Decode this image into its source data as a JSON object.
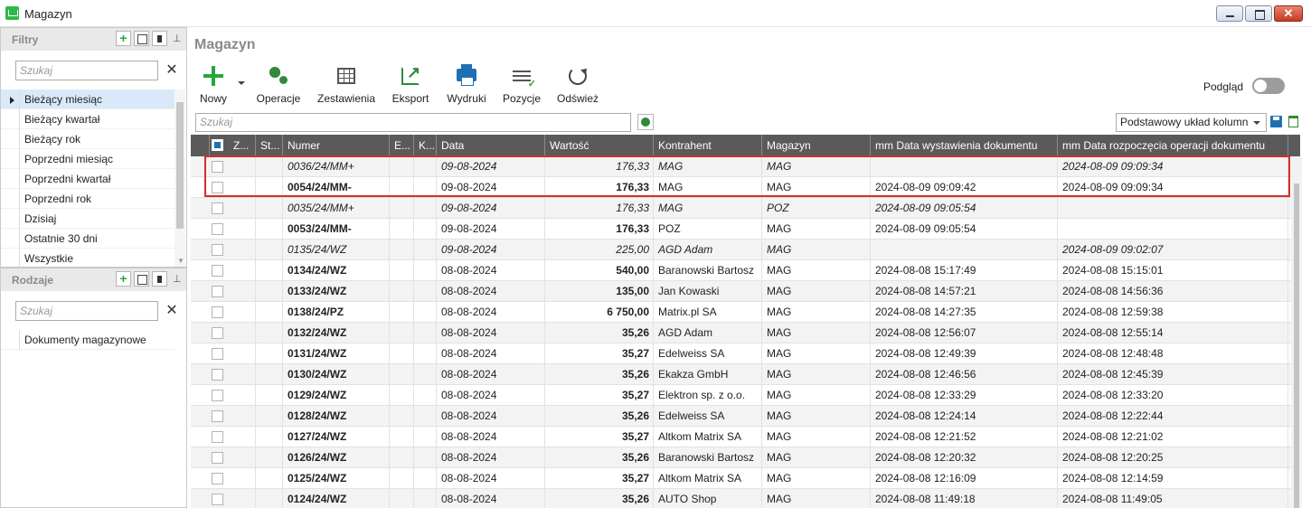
{
  "window": {
    "title": "Magazyn",
    "close_glyph": "✕"
  },
  "filters": {
    "title": "Filtry",
    "search_placeholder": "Szukaj",
    "items": [
      {
        "label": "Bieżący miesiąc",
        "active": true
      },
      {
        "label": "Bieżący kwartał"
      },
      {
        "label": "Bieżący rok"
      },
      {
        "label": "Poprzedni miesiąc"
      },
      {
        "label": "Poprzedni kwartał"
      },
      {
        "label": "Poprzedni rok"
      },
      {
        "label": "Dzisiaj"
      },
      {
        "label": "Ostatnie 30 dni"
      },
      {
        "label": "Wszystkie"
      }
    ]
  },
  "types": {
    "title": "Rodzaje",
    "search_placeholder": "Szukaj",
    "items": [
      {
        "label": "Dokumenty magazynowe"
      }
    ]
  },
  "main": {
    "title": "Magazyn",
    "toolbar": {
      "new": "Nowy",
      "operations": "Operacje",
      "reports": "Zestawienia",
      "export": "Eksport",
      "prints": "Wydruki",
      "items": "Pozycje",
      "refresh": "Odśwież"
    },
    "preview_label": "Podgląd",
    "preview_on": false,
    "grid_search_placeholder": "Szukaj",
    "layout_select": "Podstawowy układ kolumn"
  },
  "grid": {
    "columns": [
      "Z...",
      "St...",
      "Numer",
      "E...",
      "K...",
      "Data",
      "Wartość",
      "Kontrahent",
      "Magazyn",
      "mm Data wystawienia dokumentu",
      "mm Data rozpoczęcia operacji dokumentu"
    ],
    "rows": [
      {
        "draft": true,
        "numer": "0036/24/MM+",
        "data": "09-08-2024",
        "wartosc": "176,33",
        "kontrahent": "MAG",
        "magazyn": "MAG",
        "wystawienia": "",
        "rozpoczecia": "2024-08-09 09:09:34"
      },
      {
        "draft": false,
        "numer": "0054/24/MM-",
        "data": "09-08-2024",
        "wartosc": "176,33",
        "kontrahent": "MAG",
        "magazyn": "MAG",
        "wystawienia": "2024-08-09 09:09:42",
        "rozpoczecia": "2024-08-09 09:09:34"
      },
      {
        "draft": true,
        "numer": "0035/24/MM+",
        "data": "09-08-2024",
        "wartosc": "176,33",
        "kontrahent": "MAG",
        "magazyn": "POZ",
        "wystawienia": "2024-08-09 09:05:54",
        "rozpoczecia": ""
      },
      {
        "draft": false,
        "numer": "0053/24/MM-",
        "data": "09-08-2024",
        "wartosc": "176,33",
        "kontrahent": "POZ",
        "magazyn": "MAG",
        "wystawienia": "2024-08-09 09:05:54",
        "rozpoczecia": ""
      },
      {
        "draft": true,
        "numer": "0135/24/WZ",
        "data": "09-08-2024",
        "wartosc": "225,00",
        "kontrahent": "AGD Adam",
        "magazyn": "MAG",
        "wystawienia": "",
        "rozpoczecia": "2024-08-09 09:02:07"
      },
      {
        "draft": false,
        "numer": "0134/24/WZ",
        "data": "08-08-2024",
        "wartosc": "540,00",
        "kontrahent": "Baranowski Bartosz",
        "magazyn": "MAG",
        "wystawienia": "2024-08-08 15:17:49",
        "rozpoczecia": "2024-08-08 15:15:01"
      },
      {
        "draft": false,
        "numer": "0133/24/WZ",
        "data": "08-08-2024",
        "wartosc": "135,00",
        "kontrahent": "Jan Kowaski",
        "magazyn": "MAG",
        "wystawienia": "2024-08-08 14:57:21",
        "rozpoczecia": "2024-08-08 14:56:36"
      },
      {
        "draft": false,
        "numer": "0138/24/PZ",
        "data": "08-08-2024",
        "wartosc": "6 750,00",
        "kontrahent": "Matrix.pl SA",
        "magazyn": "MAG",
        "wystawienia": "2024-08-08 14:27:35",
        "rozpoczecia": "2024-08-08 12:59:38"
      },
      {
        "draft": false,
        "numer": "0132/24/WZ",
        "data": "08-08-2024",
        "wartosc": "35,26",
        "kontrahent": "AGD Adam",
        "magazyn": "MAG",
        "wystawienia": "2024-08-08 12:56:07",
        "rozpoczecia": "2024-08-08 12:55:14"
      },
      {
        "draft": false,
        "numer": "0131/24/WZ",
        "data": "08-08-2024",
        "wartosc": "35,27",
        "kontrahent": "Edelweiss SA",
        "magazyn": "MAG",
        "wystawienia": "2024-08-08 12:49:39",
        "rozpoczecia": "2024-08-08 12:48:48"
      },
      {
        "draft": false,
        "numer": "0130/24/WZ",
        "data": "08-08-2024",
        "wartosc": "35,26",
        "kontrahent": "Ekakza GmbH",
        "magazyn": "MAG",
        "wystawienia": "2024-08-08 12:46:56",
        "rozpoczecia": "2024-08-08 12:45:39"
      },
      {
        "draft": false,
        "numer": "0129/24/WZ",
        "data": "08-08-2024",
        "wartosc": "35,27",
        "kontrahent": "Elektron sp. z o.o.",
        "magazyn": "MAG",
        "wystawienia": "2024-08-08 12:33:29",
        "rozpoczecia": "2024-08-08 12:33:20"
      },
      {
        "draft": false,
        "numer": "0128/24/WZ",
        "data": "08-08-2024",
        "wartosc": "35,26",
        "kontrahent": "Edelweiss SA",
        "magazyn": "MAG",
        "wystawienia": "2024-08-08 12:24:14",
        "rozpoczecia": "2024-08-08 12:22:44"
      },
      {
        "draft": false,
        "numer": "0127/24/WZ",
        "data": "08-08-2024",
        "wartosc": "35,27",
        "kontrahent": "Altkom Matrix SA",
        "magazyn": "MAG",
        "wystawienia": "2024-08-08 12:21:52",
        "rozpoczecia": "2024-08-08 12:21:02"
      },
      {
        "draft": false,
        "numer": "0126/24/WZ",
        "data": "08-08-2024",
        "wartosc": "35,26",
        "kontrahent": "Baranowski Bartosz",
        "magazyn": "MAG",
        "wystawienia": "2024-08-08 12:20:32",
        "rozpoczecia": "2024-08-08 12:20:25"
      },
      {
        "draft": false,
        "numer": "0125/24/WZ",
        "data": "08-08-2024",
        "wartosc": "35,27",
        "kontrahent": "Altkom Matrix SA",
        "magazyn": "MAG",
        "wystawienia": "2024-08-08 12:16:09",
        "rozpoczecia": "2024-08-08 12:14:59"
      },
      {
        "draft": false,
        "numer": "0124/24/WZ",
        "data": "08-08-2024",
        "wartosc": "35,26",
        "kontrahent": "AUTO Shop",
        "magazyn": "MAG",
        "wystawienia": "2024-08-08 11:49:18",
        "rozpoczecia": "2024-08-08 11:49:05"
      }
    ]
  },
  "colors": {
    "accent_green": "#27a73b",
    "header_bg": "#5a5a5a",
    "highlight": "#d62b2b",
    "selected_filter": "#d9e9f9"
  }
}
